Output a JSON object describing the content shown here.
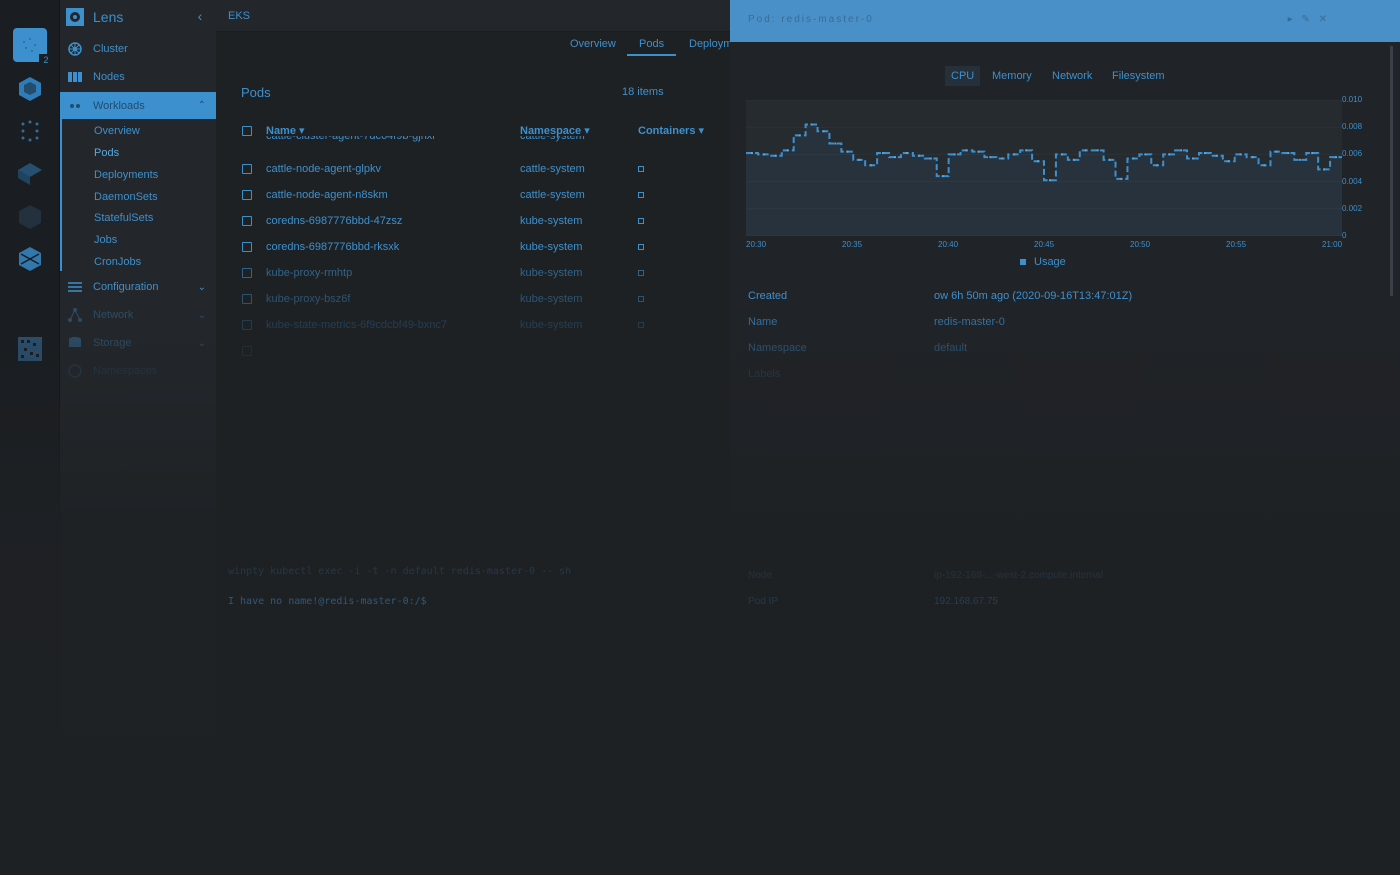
{
  "hotbar": {
    "cluster_badge": "2",
    "items": [
      "cluster-icon",
      "package-icon",
      "dots-icon",
      "cube-icon",
      "hexagon-icon",
      "box-icon",
      "grid-icon"
    ]
  },
  "sidebar": {
    "title": "Lens",
    "items": [
      {
        "label": "Cluster",
        "icon": "wheel-icon"
      },
      {
        "label": "Nodes",
        "icon": "nodes-icon"
      },
      {
        "label": "Workloads",
        "icon": "workloads-icon"
      },
      {
        "label": "Configuration",
        "icon": "list-icon"
      },
      {
        "label": "Network",
        "icon": "network-icon"
      },
      {
        "label": "Storage",
        "icon": "storage-icon"
      },
      {
        "label": "Namespaces",
        "icon": "namespace-icon"
      }
    ],
    "workloads_sub": [
      "Overview",
      "Pods",
      "Deployments",
      "DaemonSets",
      "StatefulSets",
      "Jobs",
      "CronJobs"
    ]
  },
  "topbar": {
    "title": "EKS"
  },
  "tabs": [
    "Overview",
    "Pods",
    "Deploym"
  ],
  "pods": {
    "title": "Pods",
    "count": "18 items",
    "columns": [
      "Name",
      "Namespace",
      "Containers"
    ],
    "rows": [
      {
        "name": "cattle-cluster-agent-7dc64f9b-gjhxl",
        "namespace": "cattle-system"
      },
      {
        "name": "cattle-node-agent-glpkv",
        "namespace": "cattle-system"
      },
      {
        "name": "cattle-node-agent-n8skm",
        "namespace": "cattle-system"
      },
      {
        "name": "coredns-6987776bbd-47zsz",
        "namespace": "kube-system"
      },
      {
        "name": "coredns-6987776bbd-rksxk",
        "namespace": "kube-system"
      },
      {
        "name": "kube-proxy-rmhtp",
        "namespace": "kube-system"
      },
      {
        "name": "kube-proxy-bsz6f",
        "namespace": "kube-system"
      },
      {
        "name": "kube-state-metrics-6f9cdcbf49-bxnc7",
        "namespace": "kube-system"
      }
    ]
  },
  "detail": {
    "header_title": "Pod: redis-master-0",
    "metric_tabs": [
      "CPU",
      "Memory",
      "Network",
      "Filesystem"
    ],
    "chart_legend": "Usage",
    "fields": [
      {
        "label": "Created",
        "value": "ow 6h 50m ago (2020-09-16T13:47:01Z)"
      },
      {
        "label": "Name",
        "value": "redis-master-0"
      },
      {
        "label": "Namespace",
        "value": "default"
      }
    ],
    "faded_labels": [
      "Labels"
    ],
    "bottom_labels": [
      "Node",
      "Pod IP"
    ],
    "bottom_values": [
      "ip-192-168-...-west-2.compute.internal",
      "192.168.67.75"
    ]
  },
  "terminal": {
    "line1": "I have no name!@redis-master-0:/$",
    "line2": "winpty kubectl exec -i -t -n default redis-master-0 -- sh"
  },
  "chart_data": {
    "type": "line",
    "title": "",
    "xlabel": "",
    "ylabel": "",
    "x": [
      "20:30",
      "20:35",
      "20:40",
      "20:45",
      "20:50",
      "20:55",
      "21:00"
    ],
    "ylim": [
      0,
      0.01
    ],
    "yticks": [
      "0.010",
      "0.008",
      "0.006",
      "0.004",
      "0.002",
      "0"
    ],
    "series": [
      {
        "name": "Usage",
        "values": [
          0.0061,
          0.006,
          0.0059,
          0.0063,
          0.0074,
          0.0082,
          0.0077,
          0.0068,
          0.0062,
          0.0056,
          0.0052,
          0.0061,
          0.0058,
          0.0061,
          0.0059,
          0.0057,
          0.0044,
          0.006,
          0.0063,
          0.0062,
          0.0058,
          0.0057,
          0.006,
          0.0063,
          0.0055,
          0.0041,
          0.006,
          0.0056,
          0.0063,
          0.0063,
          0.0056,
          0.0042,
          0.0057,
          0.006,
          0.0052,
          0.006,
          0.0063,
          0.0057,
          0.0061,
          0.0059,
          0.0055,
          0.006,
          0.0058,
          0.0052,
          0.0062,
          0.0061,
          0.0056,
          0.0061,
          0.0049,
          0.0058
        ]
      }
    ]
  }
}
